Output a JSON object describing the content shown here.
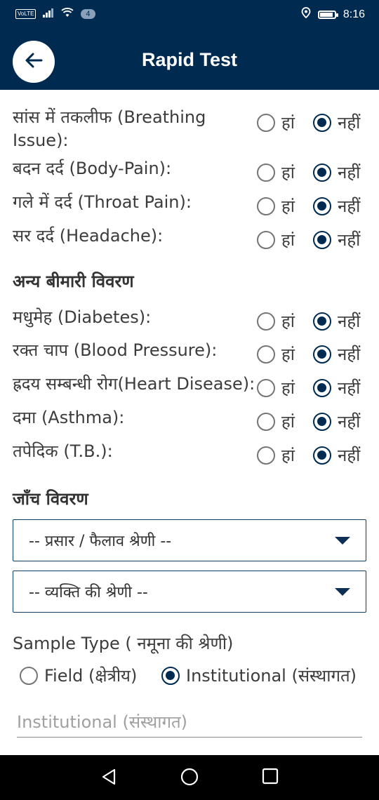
{
  "status_bar": {
    "volte": "VoLTE",
    "notification_count": "4",
    "time": "8:16"
  },
  "header": {
    "title": "Rapid Test",
    "back_icon": "arrow-left-icon"
  },
  "symptoms": [
    {
      "label_line1": "सांस में तकलीफ (Breathing",
      "label_line2": "Issue):",
      "yes": "हां",
      "no": "नहीं",
      "selected": "no"
    },
    {
      "label_line1": "बदन दर्द (Body-Pain):",
      "yes": "हां",
      "no": "नहीं",
      "selected": "no"
    },
    {
      "label_line1": "गले में दर्द (Throat Pain):",
      "yes": "हां",
      "no": "नहीं",
      "selected": "no"
    },
    {
      "label_line1": "सर दर्द (Headache):",
      "yes": "हां",
      "no": "नहीं",
      "selected": "no"
    }
  ],
  "other_illness": {
    "heading": "अन्य बीमारी विवरण",
    "items": [
      {
        "label": "मधुमेह (Diabetes):",
        "yes": "हां",
        "no": "नहीं",
        "selected": "no"
      },
      {
        "label": "रक्त चाप (Blood Pressure):",
        "yes": "हां",
        "no": "नहीं",
        "selected": "no"
      },
      {
        "label": "ह्रदय सम्बन्धी रोग(Heart Disease):",
        "yes": "हां",
        "no": "नहीं",
        "selected": "no"
      },
      {
        "label": "दमा (Asthma):",
        "yes": "हां",
        "no": "नहीं",
        "selected": "no"
      },
      {
        "label": "तपेदिक (T.B.):",
        "yes": "हां",
        "no": "नहीं",
        "selected": "no"
      }
    ]
  },
  "test_details": {
    "heading": "जाँच विवरण",
    "dropdown1": "-- प्रसार / फैलाव श्रेणी --",
    "dropdown2": "-- व्यक्ति की श्रेणी --"
  },
  "sample_type": {
    "label": "Sample Type ( नमूना की श्रेणी)",
    "option_field": "Field (क्षेत्रीय)",
    "option_institutional": "Institutional (संस्थागत)",
    "selected": "institutional",
    "input_placeholder": "Institutional (संस्थागत)"
  },
  "colors": {
    "primary": "#002a50",
    "background": "#ffffff"
  }
}
